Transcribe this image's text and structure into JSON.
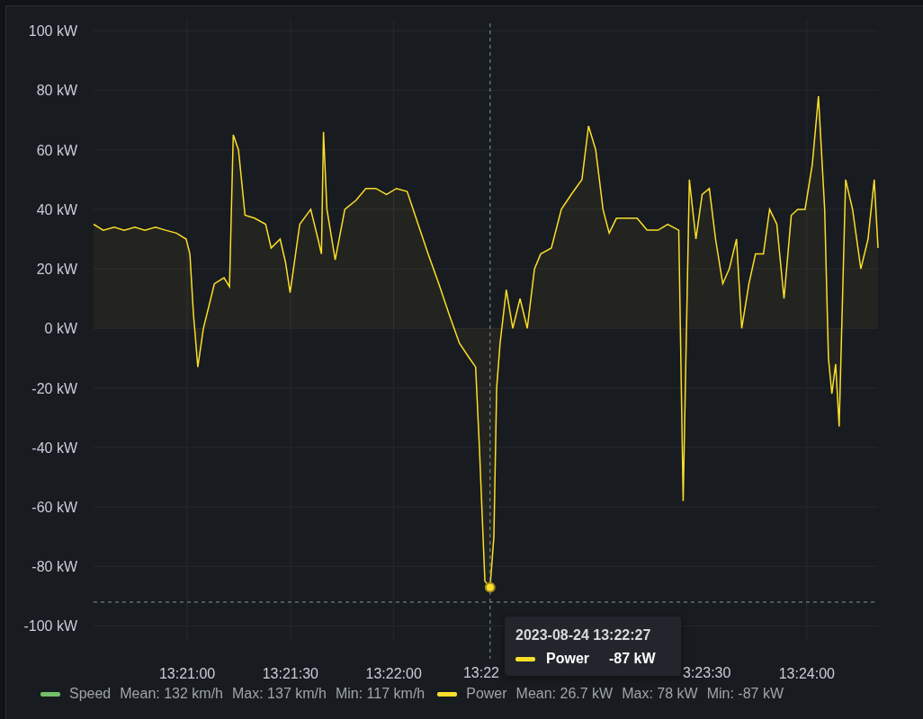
{
  "chart_data": {
    "type": "line",
    "xlim": [
      48032.8,
      48260.7
    ],
    "ylim": [
      -105,
      104
    ],
    "grid": true,
    "ref_lines": [
      {
        "axis": "y",
        "value": -92
      },
      {
        "axis": "x",
        "value": 48148
      }
    ],
    "yticks": [
      {
        "value": 100,
        "label": "100 kW"
      },
      {
        "value": 80,
        "label": "80 kW"
      },
      {
        "value": 60,
        "label": "60 kW"
      },
      {
        "value": 40,
        "label": "40 kW"
      },
      {
        "value": 20,
        "label": "20 kW"
      },
      {
        "value": 0,
        "label": "0 kW"
      },
      {
        "value": -20,
        "label": "-20 kW"
      },
      {
        "value": -40,
        "label": "-40 kW"
      },
      {
        "value": -60,
        "label": "-60 kW"
      },
      {
        "value": -80,
        "label": "-80 kW"
      },
      {
        "value": -100,
        "label": "-100 kW"
      }
    ],
    "xticks": [
      {
        "value": 48060,
        "label": "13:21:00"
      },
      {
        "value": 48090,
        "label": "13:21:30"
      },
      {
        "value": 48120,
        "label": "13:22:00"
      },
      {
        "value": 48240,
        "label": "13:24:00"
      }
    ],
    "x": [
      48032.8,
      48035.6,
      48038.8,
      48041.7,
      48044.8,
      48047.7,
      48050.8,
      48053.7,
      48056.9,
      48059.7,
      48060.8,
      48061.8,
      48063.1,
      48064.7,
      48067.9,
      48070.7,
      48072.3,
      48073.4,
      48074.9,
      48076.8,
      48079.6,
      48082.8,
      48084.4,
      48087.0,
      48088.6,
      48089.9,
      48092.7,
      48095.9,
      48098.0,
      48099.0,
      48099.6,
      48100.6,
      48103.0,
      48105.8,
      48109.0,
      48111.9,
      48114.8,
      48117.9,
      48120.8,
      48123.9,
      48127.1,
      48130.0,
      48133.1,
      48136.0,
      48139.1,
      48142.0,
      48143.8,
      48144.9,
      48146.5,
      48148.0,
      48149.1,
      48149.9,
      48150.9,
      48152.7,
      48154.6,
      48156.7,
      48158.8,
      48160.9,
      48162.7,
      48165.8,
      48168.7,
      48171.6,
      48174.7,
      48176.6,
      48178.7,
      48180.8,
      48182.6,
      48184.7,
      48187.6,
      48190.7,
      48193.6,
      48196.8,
      48199.6,
      48202.8,
      48204.1,
      48205.9,
      48207.8,
      48209.6,
      48211.7,
      48213.5,
      48215.6,
      48217.5,
      48219.6,
      48221.1,
      48223.2,
      48225.1,
      48227.4,
      48229.2,
      48231.3,
      48233.4,
      48235.5,
      48237.4,
      48239.5,
      48241.6,
      48243.4,
      48245.2,
      48246.3,
      48247.3,
      48248.4,
      48249.4,
      48251.3,
      48253.3,
      48255.7,
      48257.8,
      48259.6,
      48260.7
    ],
    "series": [
      {
        "name": "Power",
        "color": "#fade2a",
        "values": [
          35,
          33,
          34,
          33,
          34,
          33,
          34,
          33,
          32,
          30,
          25,
          5,
          -13,
          0,
          15,
          17,
          14,
          65,
          60,
          38,
          37,
          35,
          27,
          30,
          22,
          12,
          35,
          40,
          30,
          25,
          66,
          40,
          23,
          40,
          43,
          47,
          47,
          45,
          47,
          46,
          35,
          25,
          15,
          5,
          -5,
          -10,
          -13,
          -40,
          -85,
          -87,
          -70,
          -20,
          -5,
          13,
          0,
          10,
          0,
          20,
          25,
          27,
          40,
          45,
          50,
          68,
          60,
          40,
          32,
          37,
          37,
          37,
          33,
          33,
          35,
          33,
          -58,
          50,
          30,
          45,
          47,
          30,
          15,
          20,
          30,
          0,
          15,
          25,
          25,
          40,
          35,
          10,
          38,
          40,
          40,
          55,
          78,
          40,
          -10,
          -22,
          -12,
          -33,
          50,
          40,
          20,
          30,
          50,
          27
        ]
      }
    ]
  },
  "clipped_xtick_labels": [
    "13:22",
    "3:23:30"
  ],
  "tooltip": {
    "time": "2023-08-24 13:22:27",
    "value": "-87 kW",
    "color": "#fade2a"
  },
  "legend": [
    {
      "name": "Speed",
      "color": "#73bf69",
      "stats": [
        "Mean: 132 km/h",
        "Max: 137 km/h",
        "Min: 117 km/h"
      ]
    },
    {
      "name": "Power",
      "color": "#fade2a",
      "stats": [
        "Mean: 26.7 kW",
        "Max: 78 kW",
        "Min: -87 kW"
      ]
    }
  ]
}
